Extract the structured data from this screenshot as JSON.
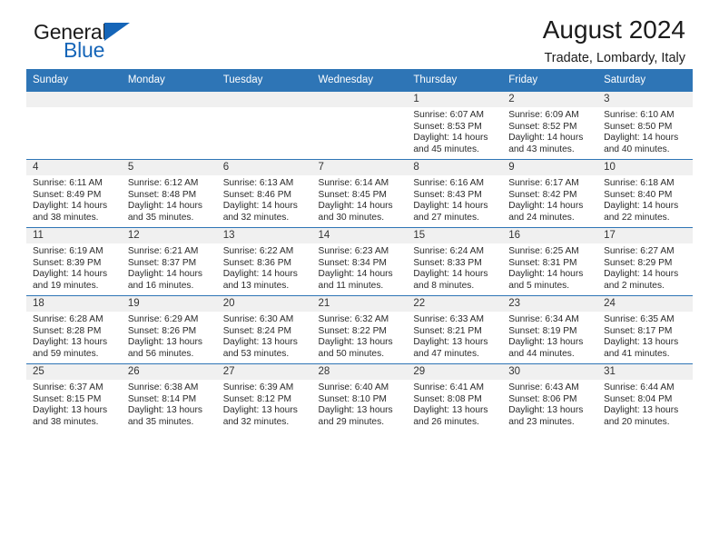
{
  "brand": {
    "name_top": "General",
    "name_bottom": "Blue",
    "accent_color": "#1565b8"
  },
  "header": {
    "title": "August 2024",
    "subtitle": "Tradate, Lombardy, Italy"
  },
  "theme": {
    "header_blue": "#2e75b6",
    "daynum_band": "#f0f0f0",
    "text": "#222222"
  },
  "weekday_headers": [
    "Sunday",
    "Monday",
    "Tuesday",
    "Wednesday",
    "Thursday",
    "Friday",
    "Saturday"
  ],
  "labels": {
    "sunrise_prefix": "Sunrise:",
    "sunset_prefix": "Sunset:",
    "daylight_prefix": "Daylight:"
  },
  "weeks": [
    [
      {
        "day": "",
        "sunrise": "",
        "sunset": "",
        "daylight_line1": "",
        "daylight_line2": ""
      },
      {
        "day": "",
        "sunrise": "",
        "sunset": "",
        "daylight_line1": "",
        "daylight_line2": ""
      },
      {
        "day": "",
        "sunrise": "",
        "sunset": "",
        "daylight_line1": "",
        "daylight_line2": ""
      },
      {
        "day": "",
        "sunrise": "",
        "sunset": "",
        "daylight_line1": "",
        "daylight_line2": ""
      },
      {
        "day": "1",
        "sunrise": "Sunrise: 6:07 AM",
        "sunset": "Sunset: 8:53 PM",
        "daylight_line1": "Daylight: 14 hours",
        "daylight_line2": "and 45 minutes."
      },
      {
        "day": "2",
        "sunrise": "Sunrise: 6:09 AM",
        "sunset": "Sunset: 8:52 PM",
        "daylight_line1": "Daylight: 14 hours",
        "daylight_line2": "and 43 minutes."
      },
      {
        "day": "3",
        "sunrise": "Sunrise: 6:10 AM",
        "sunset": "Sunset: 8:50 PM",
        "daylight_line1": "Daylight: 14 hours",
        "daylight_line2": "and 40 minutes."
      }
    ],
    [
      {
        "day": "4",
        "sunrise": "Sunrise: 6:11 AM",
        "sunset": "Sunset: 8:49 PM",
        "daylight_line1": "Daylight: 14 hours",
        "daylight_line2": "and 38 minutes."
      },
      {
        "day": "5",
        "sunrise": "Sunrise: 6:12 AM",
        "sunset": "Sunset: 8:48 PM",
        "daylight_line1": "Daylight: 14 hours",
        "daylight_line2": "and 35 minutes."
      },
      {
        "day": "6",
        "sunrise": "Sunrise: 6:13 AM",
        "sunset": "Sunset: 8:46 PM",
        "daylight_line1": "Daylight: 14 hours",
        "daylight_line2": "and 32 minutes."
      },
      {
        "day": "7",
        "sunrise": "Sunrise: 6:14 AM",
        "sunset": "Sunset: 8:45 PM",
        "daylight_line1": "Daylight: 14 hours",
        "daylight_line2": "and 30 minutes."
      },
      {
        "day": "8",
        "sunrise": "Sunrise: 6:16 AM",
        "sunset": "Sunset: 8:43 PM",
        "daylight_line1": "Daylight: 14 hours",
        "daylight_line2": "and 27 minutes."
      },
      {
        "day": "9",
        "sunrise": "Sunrise: 6:17 AM",
        "sunset": "Sunset: 8:42 PM",
        "daylight_line1": "Daylight: 14 hours",
        "daylight_line2": "and 24 minutes."
      },
      {
        "day": "10",
        "sunrise": "Sunrise: 6:18 AM",
        "sunset": "Sunset: 8:40 PM",
        "daylight_line1": "Daylight: 14 hours",
        "daylight_line2": "and 22 minutes."
      }
    ],
    [
      {
        "day": "11",
        "sunrise": "Sunrise: 6:19 AM",
        "sunset": "Sunset: 8:39 PM",
        "daylight_line1": "Daylight: 14 hours",
        "daylight_line2": "and 19 minutes."
      },
      {
        "day": "12",
        "sunrise": "Sunrise: 6:21 AM",
        "sunset": "Sunset: 8:37 PM",
        "daylight_line1": "Daylight: 14 hours",
        "daylight_line2": "and 16 minutes."
      },
      {
        "day": "13",
        "sunrise": "Sunrise: 6:22 AM",
        "sunset": "Sunset: 8:36 PM",
        "daylight_line1": "Daylight: 14 hours",
        "daylight_line2": "and 13 minutes."
      },
      {
        "day": "14",
        "sunrise": "Sunrise: 6:23 AM",
        "sunset": "Sunset: 8:34 PM",
        "daylight_line1": "Daylight: 14 hours",
        "daylight_line2": "and 11 minutes."
      },
      {
        "day": "15",
        "sunrise": "Sunrise: 6:24 AM",
        "sunset": "Sunset: 8:33 PM",
        "daylight_line1": "Daylight: 14 hours",
        "daylight_line2": "and 8 minutes."
      },
      {
        "day": "16",
        "sunrise": "Sunrise: 6:25 AM",
        "sunset": "Sunset: 8:31 PM",
        "daylight_line1": "Daylight: 14 hours",
        "daylight_line2": "and 5 minutes."
      },
      {
        "day": "17",
        "sunrise": "Sunrise: 6:27 AM",
        "sunset": "Sunset: 8:29 PM",
        "daylight_line1": "Daylight: 14 hours",
        "daylight_line2": "and 2 minutes."
      }
    ],
    [
      {
        "day": "18",
        "sunrise": "Sunrise: 6:28 AM",
        "sunset": "Sunset: 8:28 PM",
        "daylight_line1": "Daylight: 13 hours",
        "daylight_line2": "and 59 minutes."
      },
      {
        "day": "19",
        "sunrise": "Sunrise: 6:29 AM",
        "sunset": "Sunset: 8:26 PM",
        "daylight_line1": "Daylight: 13 hours",
        "daylight_line2": "and 56 minutes."
      },
      {
        "day": "20",
        "sunrise": "Sunrise: 6:30 AM",
        "sunset": "Sunset: 8:24 PM",
        "daylight_line1": "Daylight: 13 hours",
        "daylight_line2": "and 53 minutes."
      },
      {
        "day": "21",
        "sunrise": "Sunrise: 6:32 AM",
        "sunset": "Sunset: 8:22 PM",
        "daylight_line1": "Daylight: 13 hours",
        "daylight_line2": "and 50 minutes."
      },
      {
        "day": "22",
        "sunrise": "Sunrise: 6:33 AM",
        "sunset": "Sunset: 8:21 PM",
        "daylight_line1": "Daylight: 13 hours",
        "daylight_line2": "and 47 minutes."
      },
      {
        "day": "23",
        "sunrise": "Sunrise: 6:34 AM",
        "sunset": "Sunset: 8:19 PM",
        "daylight_line1": "Daylight: 13 hours",
        "daylight_line2": "and 44 minutes."
      },
      {
        "day": "24",
        "sunrise": "Sunrise: 6:35 AM",
        "sunset": "Sunset: 8:17 PM",
        "daylight_line1": "Daylight: 13 hours",
        "daylight_line2": "and 41 minutes."
      }
    ],
    [
      {
        "day": "25",
        "sunrise": "Sunrise: 6:37 AM",
        "sunset": "Sunset: 8:15 PM",
        "daylight_line1": "Daylight: 13 hours",
        "daylight_line2": "and 38 minutes."
      },
      {
        "day": "26",
        "sunrise": "Sunrise: 6:38 AM",
        "sunset": "Sunset: 8:14 PM",
        "daylight_line1": "Daylight: 13 hours",
        "daylight_line2": "and 35 minutes."
      },
      {
        "day": "27",
        "sunrise": "Sunrise: 6:39 AM",
        "sunset": "Sunset: 8:12 PM",
        "daylight_line1": "Daylight: 13 hours",
        "daylight_line2": "and 32 minutes."
      },
      {
        "day": "28",
        "sunrise": "Sunrise: 6:40 AM",
        "sunset": "Sunset: 8:10 PM",
        "daylight_line1": "Daylight: 13 hours",
        "daylight_line2": "and 29 minutes."
      },
      {
        "day": "29",
        "sunrise": "Sunrise: 6:41 AM",
        "sunset": "Sunset: 8:08 PM",
        "daylight_line1": "Daylight: 13 hours",
        "daylight_line2": "and 26 minutes."
      },
      {
        "day": "30",
        "sunrise": "Sunrise: 6:43 AM",
        "sunset": "Sunset: 8:06 PM",
        "daylight_line1": "Daylight: 13 hours",
        "daylight_line2": "and 23 minutes."
      },
      {
        "day": "31",
        "sunrise": "Sunrise: 6:44 AM",
        "sunset": "Sunset: 8:04 PM",
        "daylight_line1": "Daylight: 13 hours",
        "daylight_line2": "and 20 minutes."
      }
    ]
  ]
}
